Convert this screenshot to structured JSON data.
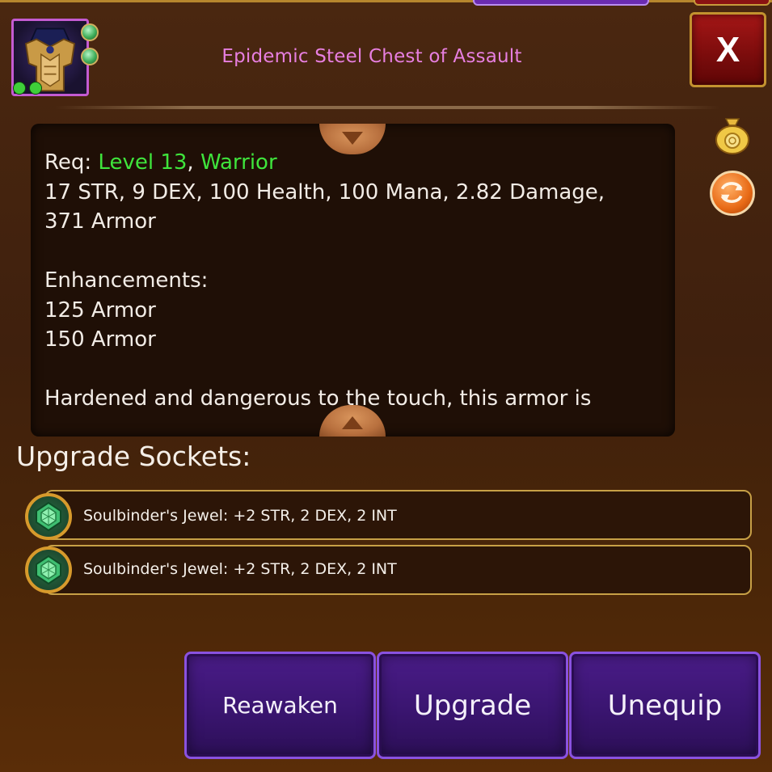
{
  "header": {
    "item_title": "Epidemic Steel Chest of Assault",
    "close_label": "X",
    "item_icon": "steel-chest-armor-icon"
  },
  "side_actions": {
    "sell_icon": "gold-coin-bag-icon",
    "swap_icon": "swap-arrows-icon"
  },
  "description": {
    "req_prefix": "Req: ",
    "req_level": "Level 13",
    "req_separator": ", ",
    "req_class": "Warrior",
    "stats_line1": "17 STR, 9 DEX, 100 Health, 100 Mana, 2.82 Damage,",
    "stats_line2": "371 Armor",
    "enhancements_heading": "Enhancements:",
    "enhancements": [
      "125 Armor",
      "150 Armor"
    ],
    "flavor_text": "Hardened and dangerous to the touch, this armor is",
    "req_color": "#3fe43c"
  },
  "sockets": {
    "heading": "Upgrade Sockets:",
    "items": [
      {
        "label": "Soulbinder's Jewel: +2 STR, 2 DEX, 2 INT",
        "icon": "green-jewel-icon"
      },
      {
        "label": "Soulbinder's Jewel: +2 STR, 2 DEX, 2 INT",
        "icon": "green-jewel-icon"
      }
    ]
  },
  "actions": {
    "reawaken_label": "Reawaken",
    "upgrade_label": "Upgrade",
    "unequip_label": "Unequip"
  },
  "colors": {
    "title": "#e77fe0",
    "button_purple": "#3a1570",
    "close_red": "#a51616",
    "gold_border": "#c7a046"
  }
}
